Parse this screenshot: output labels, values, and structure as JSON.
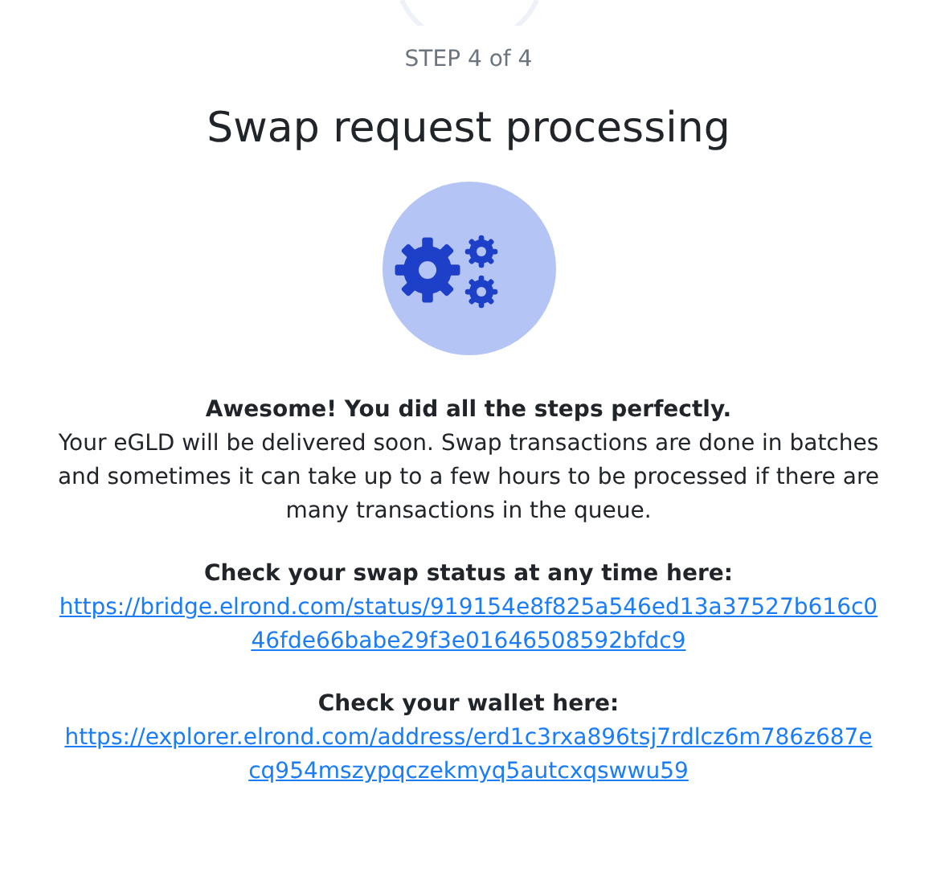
{
  "step": "STEP 4 of 4",
  "title": "Swap request processing",
  "message": {
    "headline": "Awesome! You did all the steps perfectly.",
    "body": "Your eGLD will be delivered soon. Swap transactions are done in batches and sometimes it can take up to a few hours to be processed if there are many transactions in the queue."
  },
  "links": [
    {
      "label": "Check your swap status at any time here:",
      "url": "https://bridge.elrond.com/status/919154e8f825a546ed13a37527b616c046fde66babe29f3e01646508592bfdc9"
    },
    {
      "label": "Check your wallet here:",
      "url": "https://explorer.elrond.com/address/erd1c3rxa896tsj7rdlcz6m786z687ecq954mszypqczekmyq5autcxqswwu59"
    }
  ]
}
